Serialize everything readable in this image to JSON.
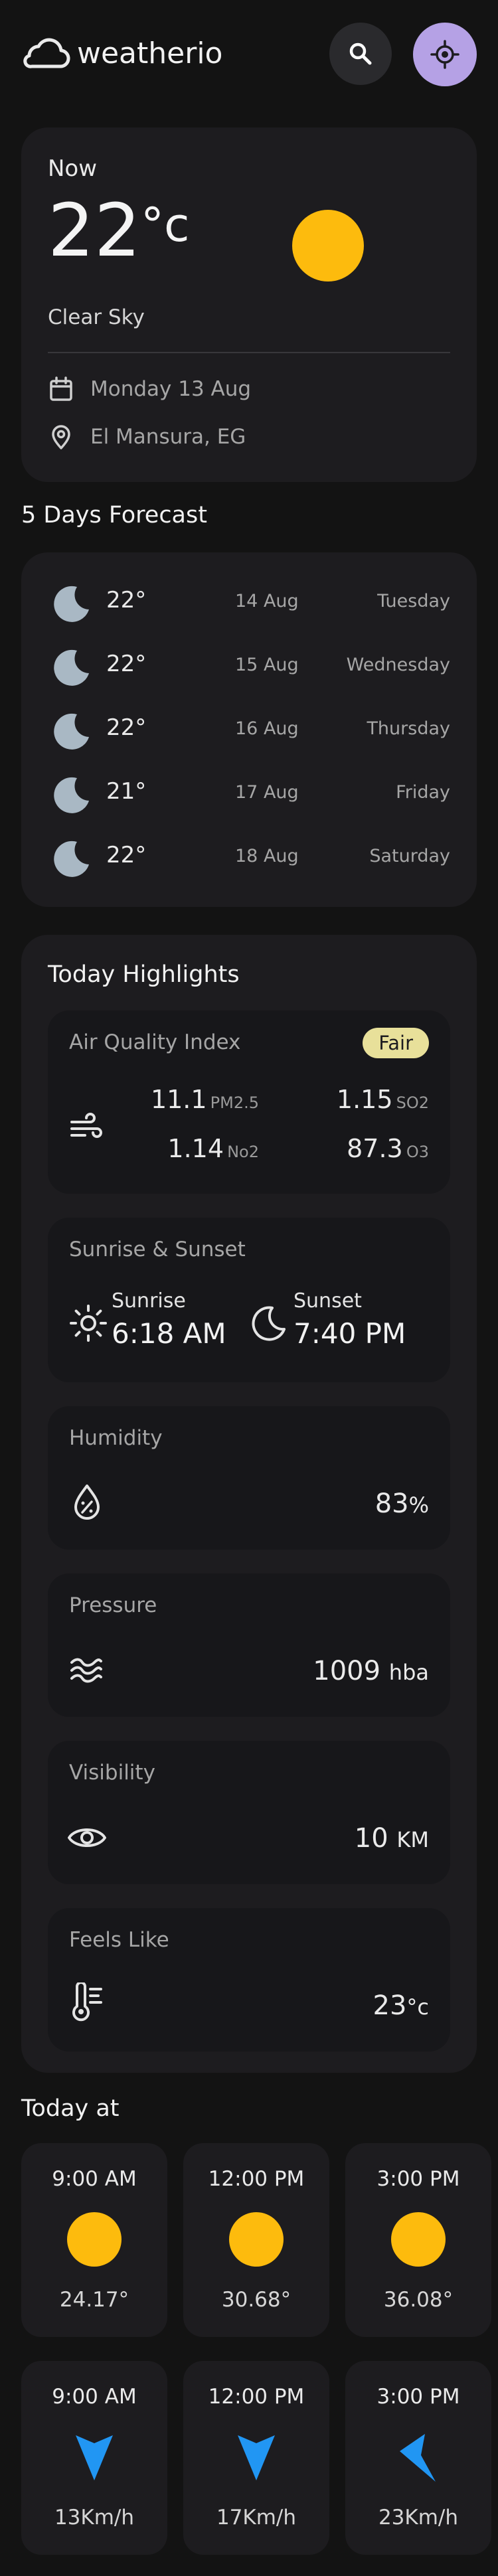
{
  "app": {
    "name": "weatherio"
  },
  "header": {
    "search_icon": "search-icon",
    "location_icon": "crosshair-icon"
  },
  "current": {
    "heading": "Now",
    "temp": "22",
    "unit": "°c",
    "condition": "Clear Sky",
    "date": "Monday 13 Aug",
    "location": "El Mansura, EG"
  },
  "forecast": {
    "title": "5 Days Forecast",
    "days": [
      {
        "temp": "22°",
        "date": "14 Aug",
        "weekday": "Tuesday"
      },
      {
        "temp": "22°",
        "date": "15 Aug",
        "weekday": "Wednesday"
      },
      {
        "temp": "22°",
        "date": "16 Aug",
        "weekday": "Thursday"
      },
      {
        "temp": "21°",
        "date": "17 Aug",
        "weekday": "Friday"
      },
      {
        "temp": "22°",
        "date": "18 Aug",
        "weekday": "Saturday"
      }
    ]
  },
  "highlights": {
    "title": "Today Highlights",
    "aqi": {
      "title": "Air Quality Index",
      "badge": "Fair",
      "pm25_value": "11.1",
      "pm25_label": "PM2.5",
      "so2_value": "1.15",
      "so2_label": "SO2",
      "no2_value": "1.14",
      "no2_label": "No2",
      "o3_value": "87.3",
      "o3_label": "O3"
    },
    "sun": {
      "title": "Sunrise & Sunset",
      "sunrise_label": "Sunrise",
      "sunrise_time": "6:18 AM",
      "sunset_label": "Sunset",
      "sunset_time": "7:40 PM"
    },
    "humidity": {
      "title": "Humidity",
      "value": "83",
      "unit": "%"
    },
    "pressure": {
      "title": "Pressure",
      "value": "1009",
      "unit": "hba"
    },
    "visibility": {
      "title": "Visibility",
      "value": "10",
      "unit": "KM"
    },
    "feels_like": {
      "title": "Feels Like",
      "value": "23",
      "unit": "°c"
    }
  },
  "today_at": {
    "title": "Today at",
    "temps": [
      {
        "time": "9:00 AM",
        "value": "24.17°"
      },
      {
        "time": "12:00 PM",
        "value": "30.68°"
      },
      {
        "time": "3:00 PM",
        "value": "36.08°"
      }
    ],
    "winds": [
      {
        "time": "9:00 AM",
        "value": "13Km/h"
      },
      {
        "time": "12:00 PM",
        "value": "17Km/h"
      },
      {
        "time": "3:00 PM",
        "value": "23Km/h"
      }
    ]
  },
  "colors": {
    "background": "#131313",
    "card": "#1d1c1f",
    "accent": "#b5a1e5",
    "sun": "#fdbb0d",
    "wind_arrow": "#2196f3",
    "badge": "#e8e09a"
  }
}
